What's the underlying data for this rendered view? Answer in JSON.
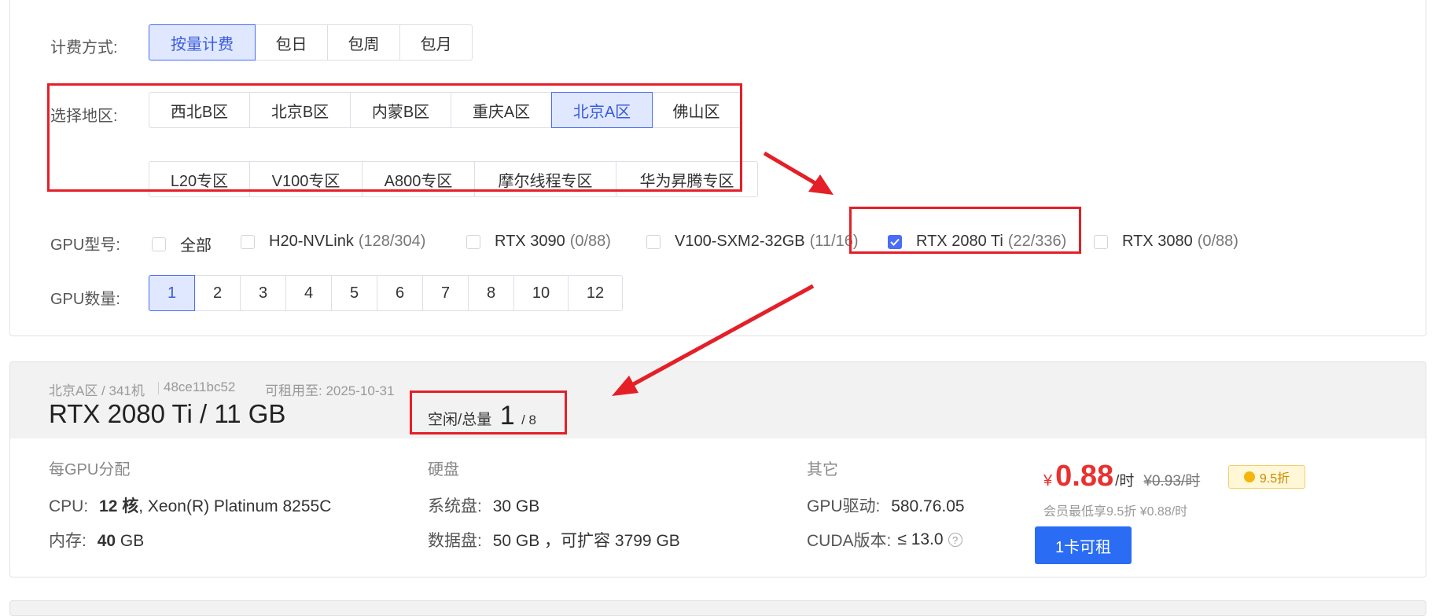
{
  "billing": {
    "label": "计费方式:",
    "options": [
      "按量计费",
      "包日",
      "包周",
      "包月"
    ],
    "selected": "按量计费"
  },
  "region": {
    "label": "选择地区:",
    "row1": [
      "西北B区",
      "北京B区",
      "内蒙B区",
      "重庆A区",
      "北京A区",
      "佛山区"
    ],
    "row2": [
      "L20专区",
      "V100专区",
      "A800专区",
      "摩尔线程专区",
      "华为昇腾专区"
    ],
    "selected": "北京A区"
  },
  "gpu_model": {
    "label": "GPU型号:",
    "options": [
      {
        "name": "全部",
        "count": "",
        "checked": false
      },
      {
        "name": "H20-NVLink",
        "count": "(128/304)",
        "checked": false
      },
      {
        "name": "RTX 3090",
        "count": "(0/88)",
        "checked": false
      },
      {
        "name": "V100-SXM2-32GB",
        "count": "(11/16)",
        "checked": false
      },
      {
        "name": "RTX 2080 Ti",
        "count": "(22/336)",
        "checked": true
      },
      {
        "name": "RTX 3080",
        "count": "(0/88)",
        "checked": false
      }
    ]
  },
  "gpu_count": {
    "label": "GPU数量:",
    "options": [
      "1",
      "2",
      "3",
      "4",
      "5",
      "6",
      "7",
      "8",
      "10",
      "12"
    ],
    "selected": "1"
  },
  "machine": {
    "region": "北京A区 / 341机",
    "machine_id": "48ce11bc52",
    "available_until": "可租用至: 2025-10-31",
    "title": "RTX 2080 Ti / 11 GB",
    "idle_label": "空闲/总量",
    "idle": "1",
    "total": "/ 8",
    "per_gpu_title": "每GPU分配",
    "cpu_key": "CPU:",
    "cpu_cores": "12 核",
    "cpu_model": ", Xeon(R) Platinum 8255C",
    "mem_key": "内存:",
    "mem_value": "40",
    "mem_unit": "GB",
    "disk_title": "硬盘",
    "sys_disk_key": "系统盘:",
    "sys_disk_value": "30 GB",
    "data_disk_key": "数据盘:",
    "data_disk_value": "50 GB ，可扩容 3799 GB",
    "other_title": "其它",
    "driver_key": "GPU驱动:",
    "driver_value": "580.76.05",
    "cuda_key": "CUDA版本:",
    "cuda_value": "≤ 13.0",
    "help_icon": "?",
    "currency": "¥",
    "price": "0.88",
    "price_unit": "/时",
    "orig_price": "¥0.93/时",
    "discount_icon": "coin-icon",
    "discount": "9.5折",
    "member_note": "会员最低享9.5折 ¥0.88/时",
    "rent_button": "1卡可租"
  },
  "colors": {
    "accent": "#4a6cf7",
    "annotation_red": "#e41f27",
    "price_red": "#e8312f",
    "rent_blue": "#2b6cf4"
  }
}
